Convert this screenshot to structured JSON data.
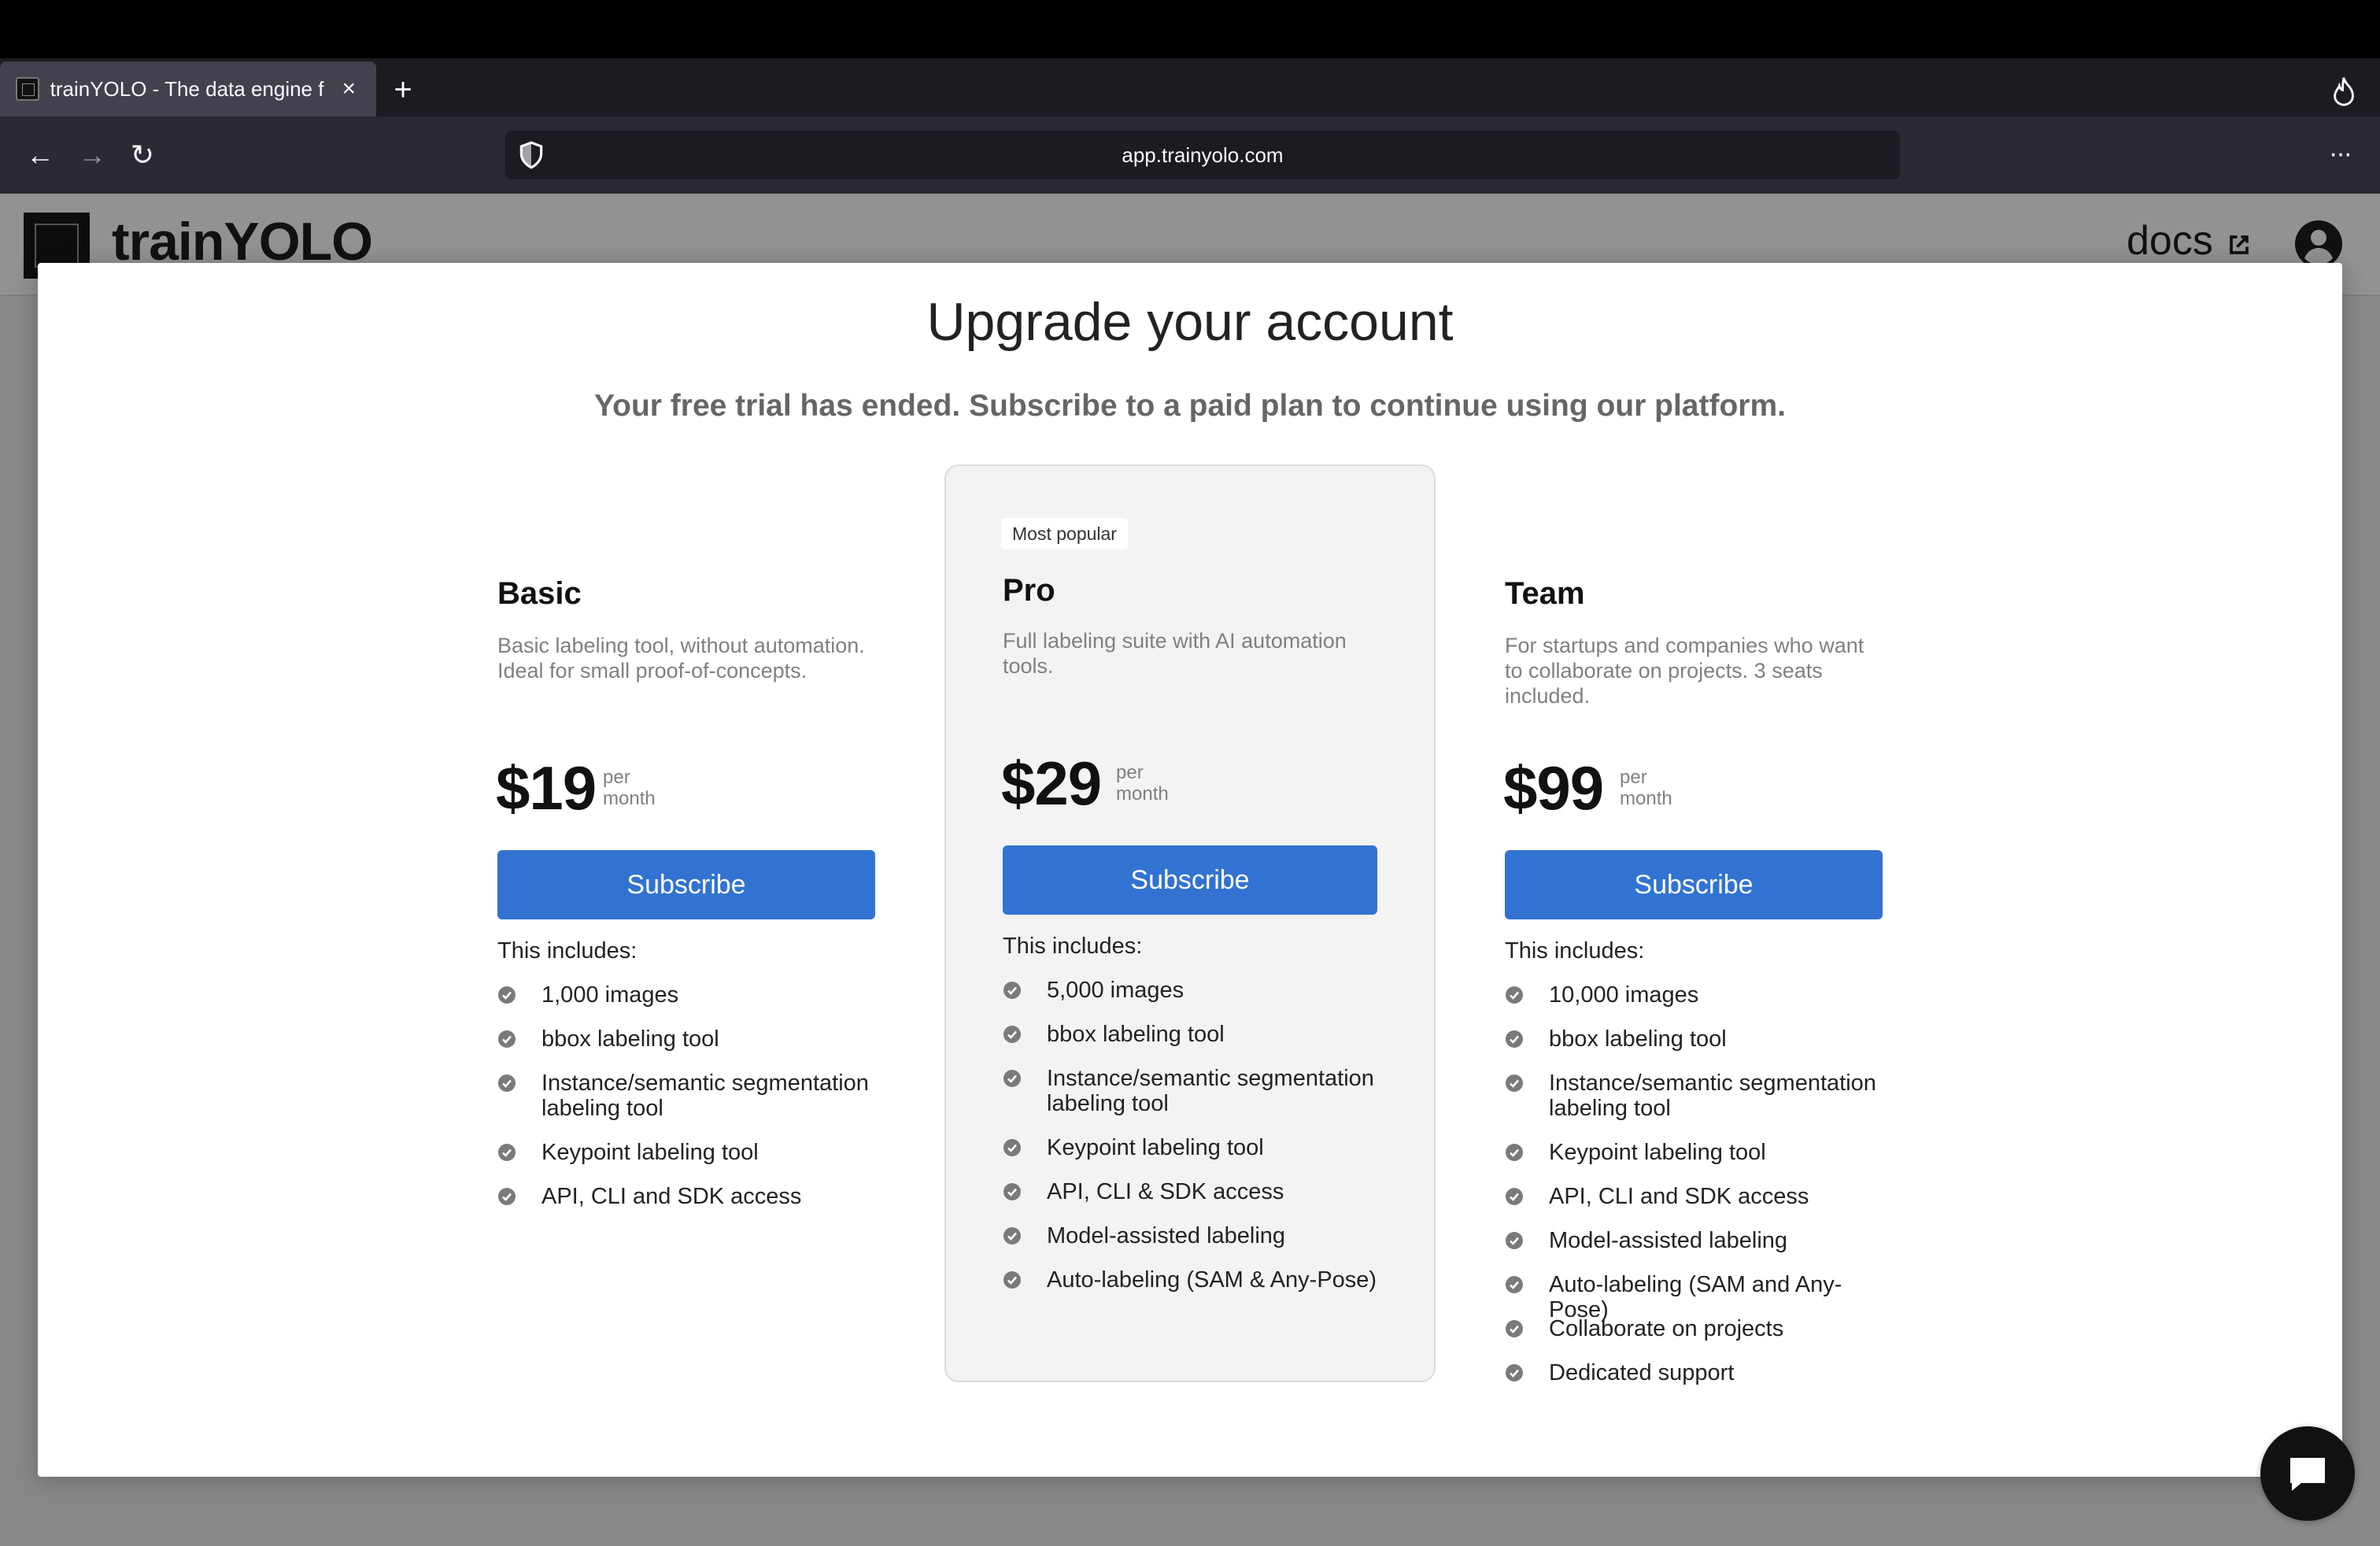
{
  "browser": {
    "tab_title": "trainYOLO - The data engine f",
    "tab_close": "×",
    "new_tab": "+",
    "back": "←",
    "forward": "→",
    "reload": "↻",
    "url": "app.trainyolo.com",
    "menu": "···"
  },
  "app": {
    "logo_text": "trainYOLO",
    "docs_label": "docs"
  },
  "modal": {
    "title": "Upgrade your account",
    "subtitle": "Your free trial has ended. Subscribe to a paid plan to continue using our platform."
  },
  "plans": [
    {
      "name": "Basic",
      "description": "Basic labeling tool, without automation. Ideal for small proof-of-concepts.",
      "price": "$19",
      "per": "per",
      "period": "month",
      "button": "Subscribe",
      "includes": "This includes:",
      "features": [
        "1,000 images",
        "bbox labeling tool",
        "Instance/semantic segmentation labeling tool",
        "Keypoint labeling tool",
        "API, CLI and SDK access"
      ]
    },
    {
      "name": "Pro",
      "badge": "Most popular",
      "description": "Full labeling suite with AI automation tools.",
      "price": "$29",
      "per": "per",
      "period": "month",
      "button": "Subscribe",
      "includes": "This includes:",
      "features": [
        "5,000 images",
        "bbox labeling tool",
        "Instance/semantic segmentation labeling tool",
        "Keypoint labeling tool",
        "API, CLI & SDK access",
        "Model-assisted labeling",
        "Auto-labeling (SAM & Any-Pose)"
      ]
    },
    {
      "name": "Team",
      "description": "For startups and companies who want to collaborate on projects. 3 seats included.",
      "price": "$99",
      "per": "per",
      "period": "month",
      "button": "Subscribe",
      "includes": "This includes:",
      "features": [
        "10,000 images",
        "bbox labeling tool",
        "Instance/semantic segmentation labeling tool",
        "Keypoint labeling tool",
        "API, CLI and SDK access",
        "Model-assisted labeling",
        "Auto-labeling (SAM and Any-Pose)",
        "Collaborate on projects",
        "Dedicated support"
      ]
    }
  ],
  "colors": {
    "primary": "#3273d1",
    "pro_card_bg": "#f3f3f4"
  }
}
